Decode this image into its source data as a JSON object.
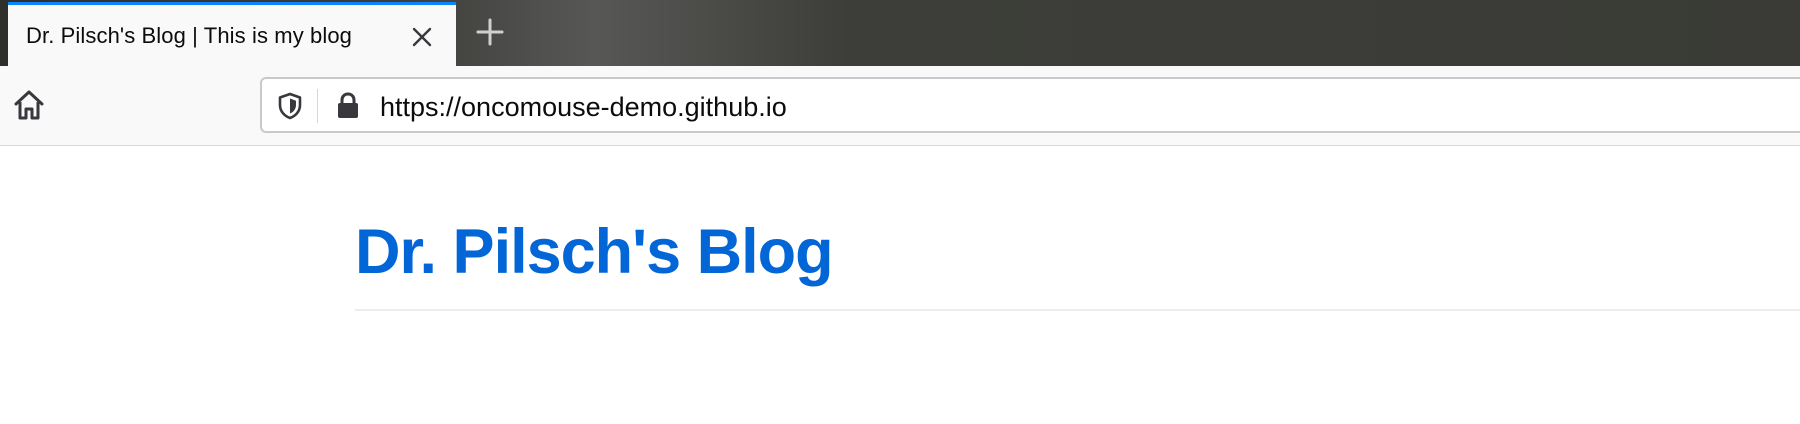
{
  "tab": {
    "title": "Dr. Pilsch's Blog | This is my blog",
    "close_icon": "close-icon",
    "accent_color": "#0a84ff"
  },
  "new_tab": {
    "icon": "plus-icon"
  },
  "navbar": {
    "home_icon": "home-icon",
    "url": "https://oncomouse-demo.github.io",
    "tracking_icon": "shield-icon",
    "security_icon": "lock-icon"
  },
  "page": {
    "site_title": "Dr. Pilsch's Blog",
    "title_color": "#0366d6"
  }
}
